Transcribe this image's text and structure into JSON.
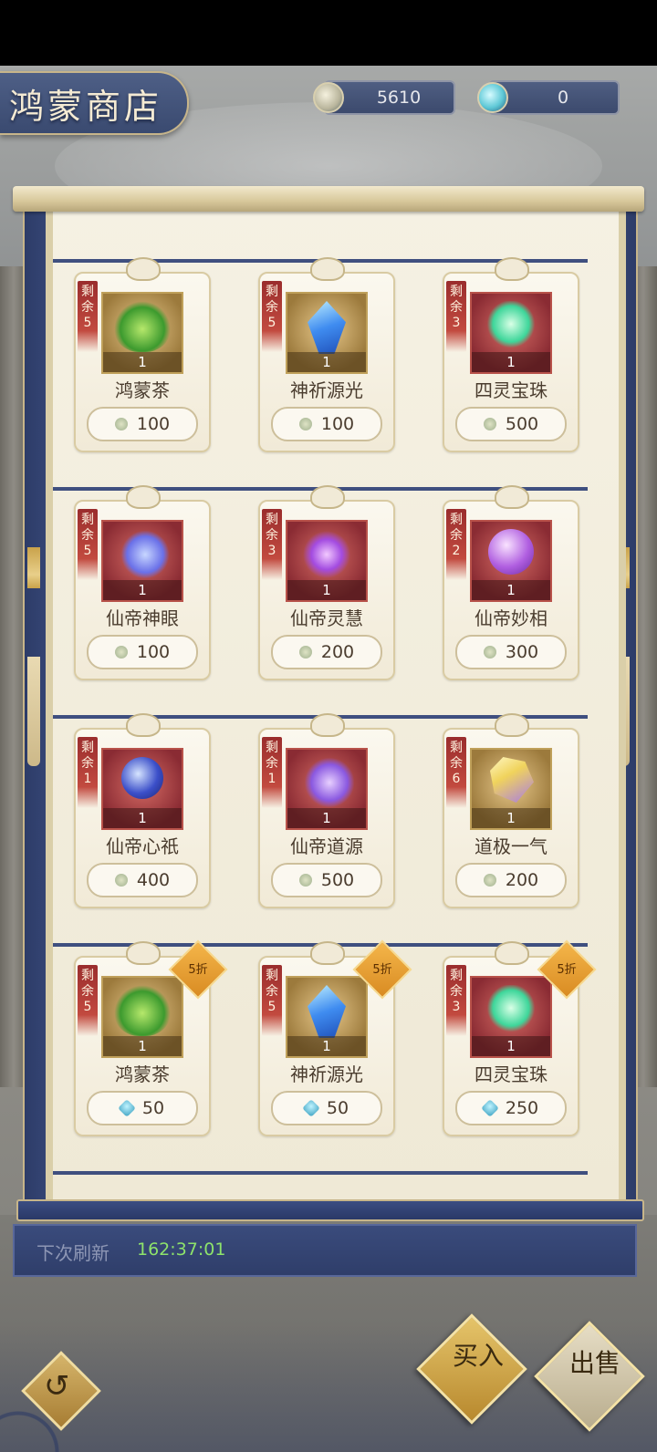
{
  "shop": {
    "title": "鸿蒙商店"
  },
  "currencies": [
    {
      "icon": "spirit-coin-icon",
      "value": "5610"
    },
    {
      "icon": "gem-icon",
      "value": "0"
    }
  ],
  "remain_label": [
    "剩",
    "余"
  ],
  "items": [
    {
      "name": "鸿蒙茶",
      "remain": "5",
      "count": "1",
      "price": "100",
      "currency": "spirit-coin",
      "art": "leaf",
      "frame": "gold",
      "discount": ""
    },
    {
      "name": "神祈源光",
      "remain": "5",
      "count": "1",
      "price": "100",
      "currency": "spirit-coin",
      "art": "crystal",
      "frame": "gold",
      "discount": ""
    },
    {
      "name": "四灵宝珠",
      "remain": "3",
      "count": "1",
      "price": "500",
      "currency": "spirit-coin",
      "art": "pearl",
      "frame": "red",
      "discount": ""
    },
    {
      "name": "仙帝神眼",
      "remain": "5",
      "count": "1",
      "price": "100",
      "currency": "spirit-coin",
      "art": "moon",
      "frame": "red",
      "discount": ""
    },
    {
      "name": "仙帝灵慧",
      "remain": "3",
      "count": "1",
      "price": "200",
      "currency": "spirit-coin",
      "art": "flower",
      "frame": "red",
      "discount": ""
    },
    {
      "name": "仙帝妙相",
      "remain": "2",
      "count": "1",
      "price": "300",
      "currency": "spirit-coin",
      "art": "orb",
      "frame": "red",
      "discount": ""
    },
    {
      "name": "仙帝心祇",
      "remain": "1",
      "count": "1",
      "price": "400",
      "currency": "spirit-coin",
      "art": "yinyang",
      "frame": "red",
      "discount": ""
    },
    {
      "name": "仙帝道源",
      "remain": "1",
      "count": "1",
      "price": "500",
      "currency": "spirit-coin",
      "art": "swirl",
      "frame": "red",
      "discount": ""
    },
    {
      "name": "道极一气",
      "remain": "6",
      "count": "1",
      "price": "200",
      "currency": "spirit-coin",
      "art": "gem",
      "frame": "gold",
      "discount": ""
    },
    {
      "name": "鸿蒙茶",
      "remain": "5",
      "count": "1",
      "price": "50",
      "currency": "gem",
      "art": "leaf",
      "frame": "gold",
      "discount": "5折"
    },
    {
      "name": "神祈源光",
      "remain": "5",
      "count": "1",
      "price": "50",
      "currency": "gem",
      "art": "crystal",
      "frame": "gold",
      "discount": "5折"
    },
    {
      "name": "四灵宝珠",
      "remain": "3",
      "count": "1",
      "price": "250",
      "currency": "gem",
      "art": "pearl",
      "frame": "red",
      "discount": "5折"
    }
  ],
  "refresh": {
    "label": "下次刷新",
    "time": "162:37:01"
  },
  "buttons": {
    "buy": "买入",
    "sell": "出售"
  },
  "colors": {
    "panel": "#3d4f82",
    "paper": "#f5f1e3",
    "accent_gold": "#d9a23a",
    "timer": "#8ee36b"
  }
}
